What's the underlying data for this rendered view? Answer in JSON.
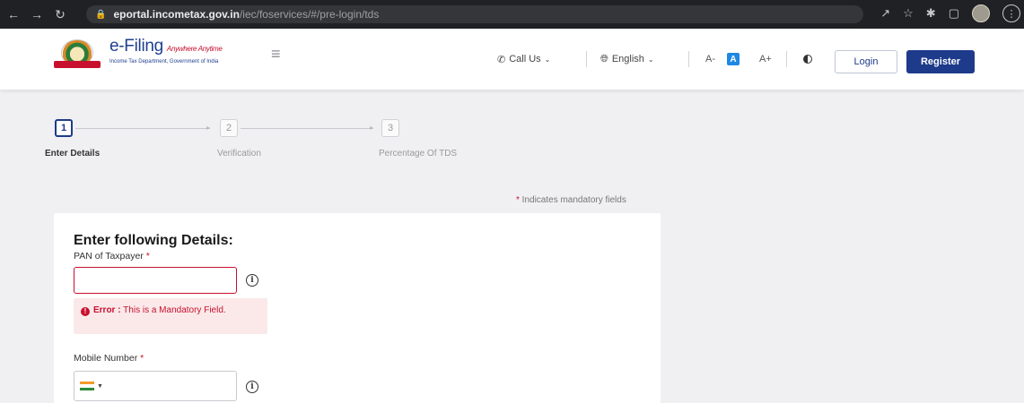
{
  "browser": {
    "url_host": "eportal.incometax.gov.in",
    "url_path": "/iec/foservices/#/pre-login/tds"
  },
  "header": {
    "brand": "e-Filing",
    "brand_tagline": "Anywhere Anytime",
    "brand_sub": "Income Tax Department, Government of India",
    "call_us": "Call Us",
    "language": "English",
    "font_decrease": "A-",
    "font_default": "A",
    "font_increase": "A+",
    "login": "Login",
    "register": "Register"
  },
  "stepper": {
    "steps": [
      {
        "number": "1",
        "label": "Enter Details",
        "active": true
      },
      {
        "number": "2",
        "label": "Verification",
        "active": false
      },
      {
        "number": "3",
        "label": "Percentage Of TDS",
        "active": false
      }
    ]
  },
  "form": {
    "mandatory_note": "Indicates mandatory fields",
    "title": "Enter following Details:",
    "pan_label": "PAN of Taxpayer",
    "pan_value": "",
    "error_prefix": "Error :",
    "error_text": "This is a Mandatory Field.",
    "mobile_label": "Mobile Number",
    "mobile_value": ""
  },
  "colors": {
    "primary": "#1e3a8a",
    "error": "#c8102e",
    "error_bg": "#fbe9e9",
    "page_bg": "#f0f0f3"
  }
}
